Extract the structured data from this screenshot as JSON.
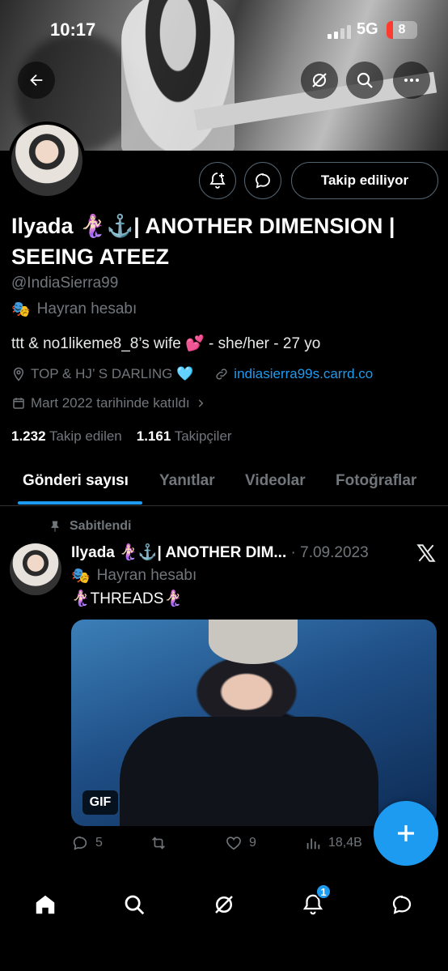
{
  "status_bar": {
    "time": "10:17",
    "network": "5G",
    "battery": "8",
    "battery_level": 0.08
  },
  "icons": {
    "back": "arrow-left-icon",
    "grok": "grok-icon",
    "search": "search-icon",
    "more": "more-horizontal-icon",
    "notify": "bell-plus-icon",
    "message": "message-bubble-icon",
    "category": "theater-mask-icon",
    "location": "location-pin-icon",
    "link": "link-icon",
    "calendar": "calendar-icon",
    "pin": "pin-icon",
    "close": "x-logo-icon"
  },
  "profile": {
    "follow_button": "Takip ediliyor",
    "name": "Ilyada 🧜🏻‍♀️⚓️| ANOTHER DIMENSION | SEEING ATEEZ",
    "handle": "@IndiaSierra99",
    "category": "Hayran hesabı",
    "bio": "ttt & no1likeme8_8’s wife 💕 - she/her - 27 yo",
    "location": "TOP & HJ’ S DARLING 🩵",
    "website": "indiasierra99s.carrd.co",
    "joined": "Mart 2022 tarihinde katıldı",
    "following_count": "1.232",
    "following_label": "Takip edilen",
    "followers_count": "1.161",
    "followers_label": "Takipçiler"
  },
  "tabs": [
    {
      "label": "Gönderi sayısı",
      "active": true
    },
    {
      "label": "Yanıtlar",
      "active": false
    },
    {
      "label": "Videolar",
      "active": false
    },
    {
      "label": "Fotoğraflar",
      "active": false
    }
  ],
  "pinned_post": {
    "pinned_label": "Sabitlendi",
    "author": "Ilyada 🧜🏻‍♀️⚓️| ANOTHER DIM...",
    "date": "· 7.09.2023",
    "category": "Hayran hesabı",
    "text": "🧜🏻‍♀️THREADS🧜🏻‍♀️",
    "media_badge": "GIF",
    "replies": "5",
    "likes": "9",
    "views": "18,4B"
  },
  "bottom_nav": {
    "home": "home-icon",
    "search": "search-icon",
    "grok": "grok-icon",
    "notifications": "bell-icon",
    "notifications_badge": "1",
    "messages": "mail-icon"
  },
  "colors": {
    "accent": "#1d9bf0",
    "background": "#000000",
    "muted": "#71767b"
  }
}
